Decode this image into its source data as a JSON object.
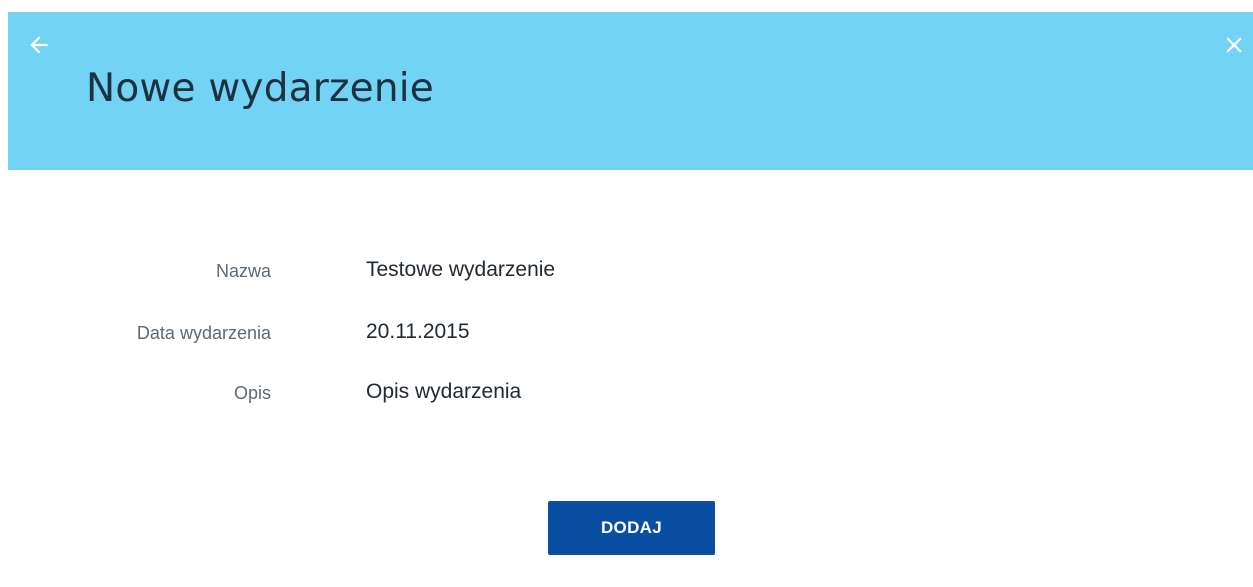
{
  "colors": {
    "header_background": "#72d3f4",
    "button_background": "#0a4ea1",
    "title_text": "#1f3140"
  },
  "header": {
    "title": "Nowe wydarzenie",
    "back_icon": "arrow-left-icon",
    "close_icon": "close-icon"
  },
  "form": {
    "fields": [
      {
        "label": "Nazwa",
        "value": "Testowe wydarzenie"
      },
      {
        "label": "Data wydarzenia",
        "value": "20.11.2015"
      },
      {
        "label": "Opis",
        "value": "Opis wydarzenia"
      }
    ]
  },
  "actions": {
    "add_label": "DODAJ"
  }
}
